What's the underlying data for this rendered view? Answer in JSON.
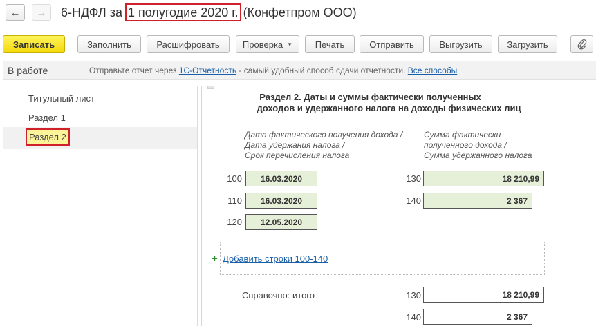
{
  "window": {
    "nav_back_icon": "arrow-left-icon",
    "nav_forward_icon": "arrow-right-icon",
    "title_prefix": "6-НДФЛ за",
    "title_period": "1 полугодие 2020 г.",
    "title_org": "(Конфетпром ООО)"
  },
  "toolbar": {
    "save": "Записать",
    "fill": "Заполнить",
    "decode": "Расшифровать",
    "check": "Проверка",
    "print": "Печать",
    "send": "Отправить",
    "export": "Выгрузить",
    "import": "Загрузить",
    "attach_icon": "paperclip-icon"
  },
  "infobar": {
    "status": "В работе",
    "text_before": "Отправьте отчет через ",
    "link_service": "1С-Отчетность",
    "text_after": " - самый удобный способ сдачи отчетности. ",
    "link_all": "Все способы"
  },
  "sidebar": {
    "items": [
      {
        "label": "Титульный лист"
      },
      {
        "label": "Раздел 1"
      },
      {
        "label": "Раздел 2"
      }
    ]
  },
  "section": {
    "title_line1": "Раздел 2.  Даты и суммы фактически полученных",
    "title_line2": "доходов и удержанного налога на доходы физических лиц",
    "left_head_1": "Дата фактического получения дохода /",
    "left_head_2": "Дата удержания налога /",
    "left_head_3": "Срок перечисления налога",
    "right_head_1": "Сумма фактически",
    "right_head_2": "полученного дохода /",
    "right_head_3": "Сумма удержанного налога",
    "rows": [
      {
        "code": "100",
        "value": "16.03.2020"
      },
      {
        "code": "110",
        "value": "16.03.2020"
      },
      {
        "code": "120",
        "value": "12.05.2020"
      }
    ],
    "amounts": [
      {
        "code": "130",
        "value": "18 210,99"
      },
      {
        "code": "140",
        "value": "2 367"
      }
    ],
    "add_rows_link": "Добавить строки 100-140",
    "reference_label": "Справочно: итого",
    "totals": [
      {
        "code": "130",
        "value": "18 210,99"
      },
      {
        "code": "140",
        "value": "2 367"
      }
    ]
  }
}
